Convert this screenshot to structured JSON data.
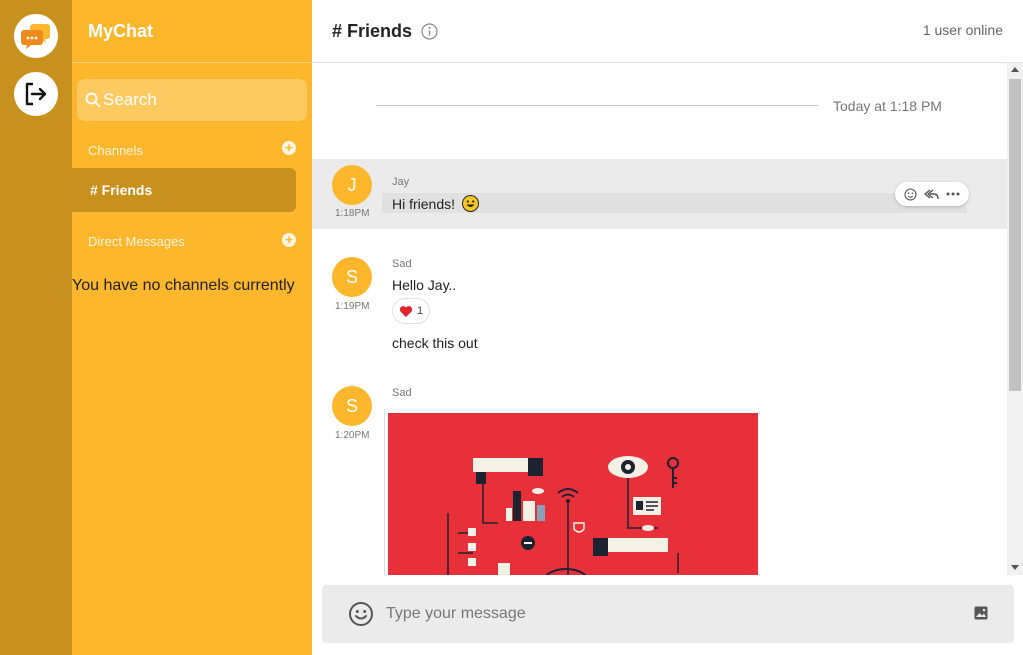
{
  "app": {
    "title": "MyChat"
  },
  "rail": {
    "chat_icon": "chat-bubbles-icon",
    "logout_icon": "logout-icon"
  },
  "sidebar": {
    "search_placeholder": "Search",
    "channels_label": "Channels",
    "dms_label": "Direct Messages",
    "active_channel": "# Friends",
    "empty_text": "You have no channels currently"
  },
  "header": {
    "title": "# Friends",
    "online": "1 user online"
  },
  "messages": {
    "date_separator": "Today at 1:18 PM",
    "items": [
      {
        "avatar": "J",
        "time": "1:18PM",
        "author": "Jay",
        "text": "Hi friends!",
        "emoji": "grinning-face"
      },
      {
        "avatar": "S",
        "time": "1:19PM",
        "author": "Sad",
        "text": "Hello Jay..",
        "reaction_count": "1",
        "reaction_emoji": "red-heart",
        "text2": "check this out"
      },
      {
        "avatar": "S",
        "time": "1:20PM",
        "author": "Sad",
        "attachment": "image"
      }
    ]
  },
  "composer": {
    "placeholder": "Type your message"
  },
  "colors": {
    "rail": "#c8901c",
    "sidebar": "#fcb72c",
    "accent": "#fcb72c",
    "image_bg": "#e8303a"
  }
}
